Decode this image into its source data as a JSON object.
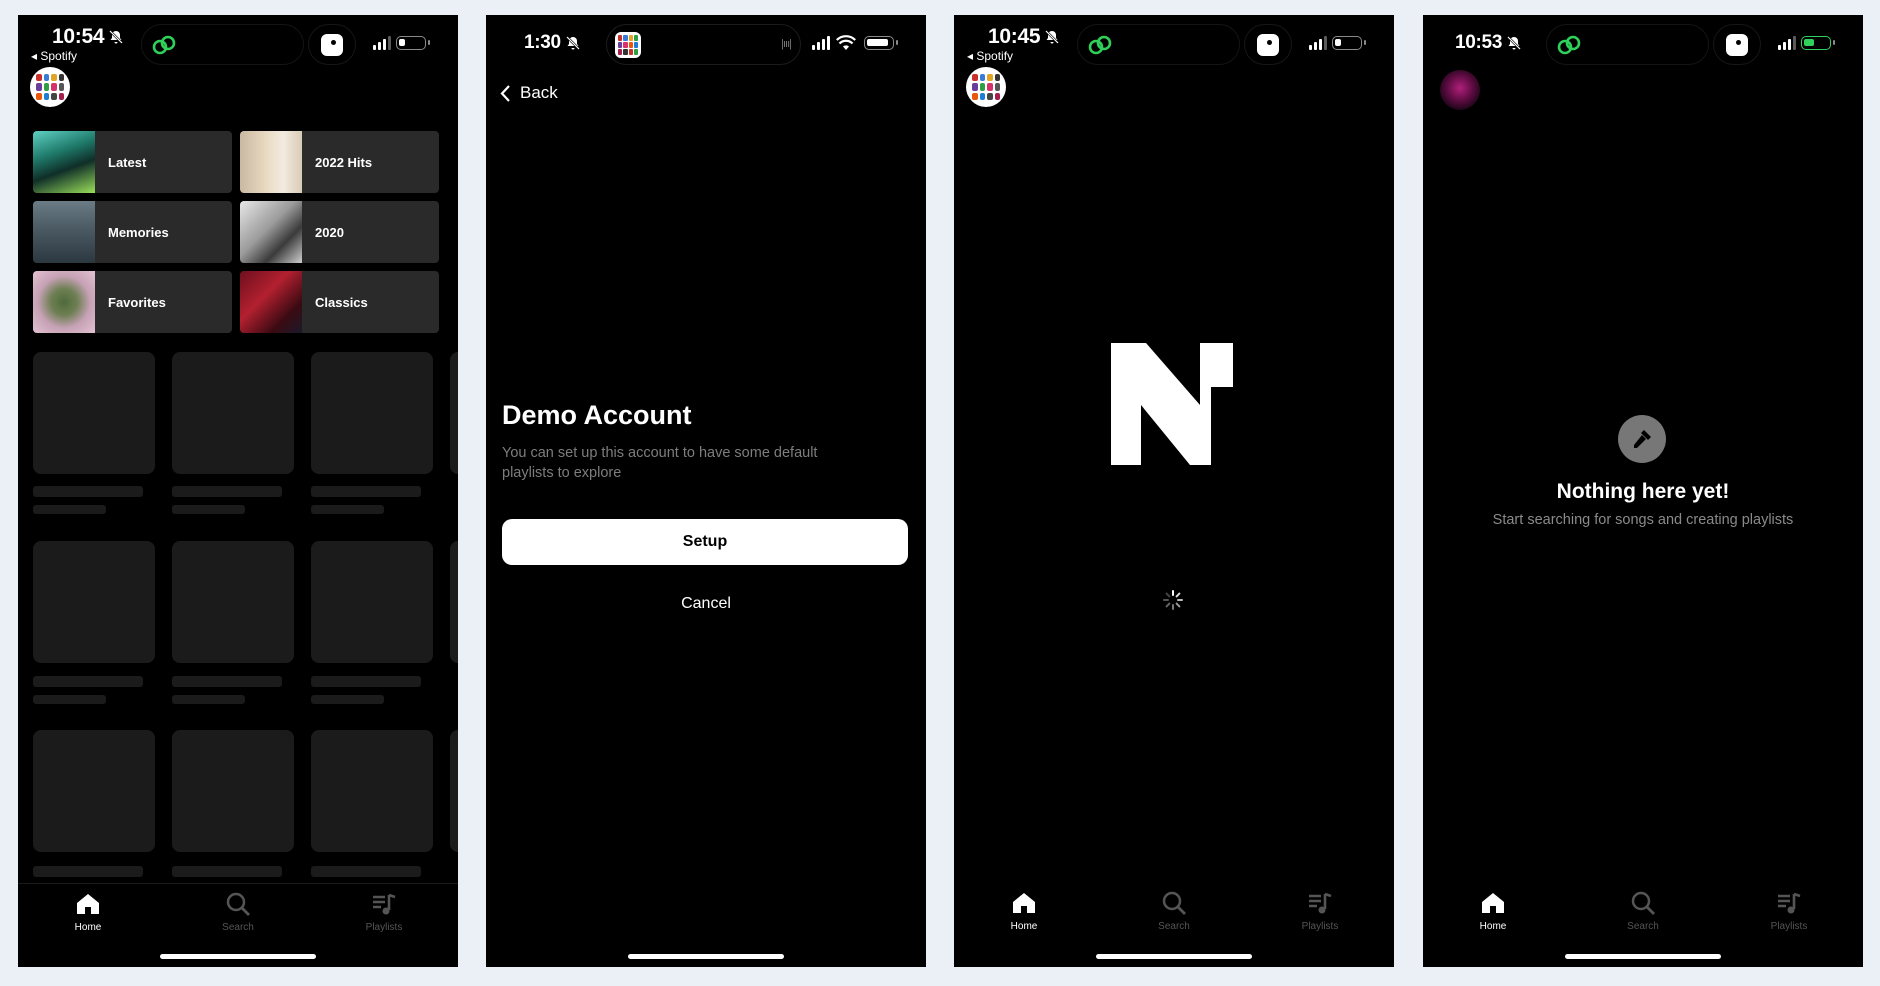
{
  "screens": [
    {
      "status": {
        "time": "10:54",
        "back_app": "◂ Spotify"
      },
      "tiles": [
        {
          "label": "Latest"
        },
        {
          "label": "2022 Hits"
        },
        {
          "label": "Memories"
        },
        {
          "label": "2020"
        },
        {
          "label": "Favorites"
        },
        {
          "label": "Classics"
        }
      ],
      "tabs": [
        "Home",
        "Search",
        "Playlists"
      ]
    },
    {
      "status": {
        "time": "1:30"
      },
      "back_label": "Back",
      "title": "Demo Account",
      "description": "You can set up this account to have some default playlists to explore",
      "setup_label": "Setup",
      "cancel_label": "Cancel"
    },
    {
      "status": {
        "time": "10:45",
        "back_app": "◂ Spotify"
      },
      "tabs": [
        "Home",
        "Search",
        "Playlists"
      ]
    },
    {
      "status": {
        "time": "10:53"
      },
      "empty_title": "Nothing here yet!",
      "empty_subtitle": "Start searching for songs and creating playlists",
      "tabs": [
        "Home",
        "Search",
        "Playlists"
      ]
    }
  ],
  "colors": {
    "background": "#eaf0f6",
    "screen": "#000000",
    "tile": "#2a2a2a",
    "skeleton": "#1b1b1b",
    "accent_green": "#2fd15a",
    "tab_inactive": "#555555"
  },
  "icons": [
    "bell-slash-icon",
    "link-icon",
    "signal-icon",
    "wifi-icon",
    "battery-icon",
    "chevron-left-icon",
    "home-icon",
    "search-icon",
    "music-note-icon",
    "microphone-icon",
    "spinner-icon"
  ]
}
